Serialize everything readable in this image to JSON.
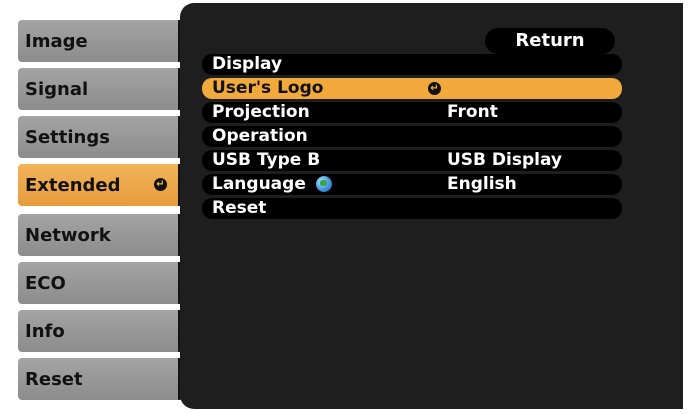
{
  "left_menu": {
    "items": [
      {
        "label": "Image"
      },
      {
        "label": "Signal"
      },
      {
        "label": "Settings"
      },
      {
        "label": "Extended",
        "selected": true
      },
      {
        "label": "Network"
      },
      {
        "label": "ECO"
      },
      {
        "label": "Info"
      },
      {
        "label": "Reset"
      }
    ]
  },
  "main": {
    "return_label": "Return",
    "rows": [
      {
        "label": "Display",
        "value": ""
      },
      {
        "label": "User's Logo",
        "value": "",
        "selected": true
      },
      {
        "label": "Projection",
        "value": "Front"
      },
      {
        "label": "Operation",
        "value": ""
      },
      {
        "label": "USB Type B",
        "value": "USB Display"
      },
      {
        "label": "Language",
        "value": "English"
      },
      {
        "label": "Reset",
        "value": ""
      }
    ]
  },
  "colors": {
    "accent": "#f2a93b",
    "menu_gray": "#9a9a9a",
    "panel_bg": "#1e1e1e"
  },
  "icons": {
    "enter": "enter-icon",
    "globe": "globe-icon"
  }
}
